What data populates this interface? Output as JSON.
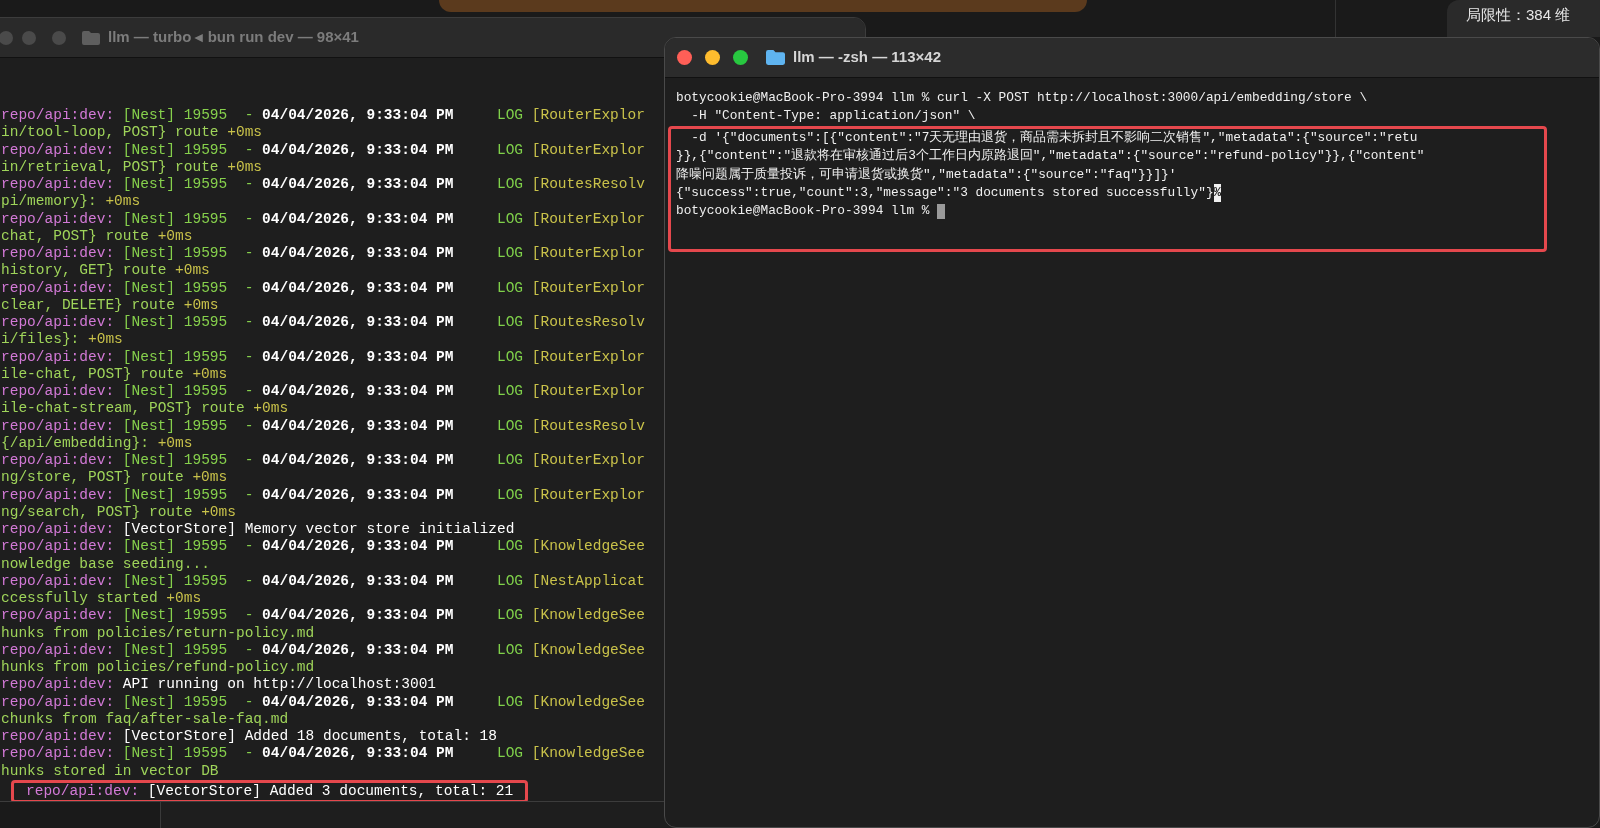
{
  "background_panel": {
    "text": "局限性：384 维"
  },
  "left_terminal": {
    "title": "llm — turbo ◂ bun run dev — 98×41",
    "lines": [
      {
        "kind": "log",
        "prefix": "repo/api:dev:",
        "source": "[Nest] 19595  -",
        "timestamp": "04/04/2026, 9:33:04 PM",
        "level": "LOG",
        "context": "[RouterExplor",
        "highlighted": false
      },
      {
        "kind": "cont",
        "text": "in/tool-loop, POST} route",
        "ms": "+0ms",
        "highlighted": false
      },
      {
        "kind": "log",
        "prefix": "repo/api:dev:",
        "source": "[Nest] 19595  -",
        "timestamp": "04/04/2026, 9:33:04 PM",
        "level": "LOG",
        "context": "[RouterExplor",
        "highlighted": false
      },
      {
        "kind": "cont",
        "text": "in/retrieval, POST} route",
        "ms": "+0ms",
        "highlighted": false
      },
      {
        "kind": "log",
        "prefix": "repo/api:dev:",
        "source": "[Nest] 19595  -",
        "timestamp": "04/04/2026, 9:33:04 PM",
        "level": "LOG",
        "context": "[RoutesResolv",
        "highlighted": false
      },
      {
        "kind": "cont",
        "text": "pi/memory}:",
        "ms": "+0ms",
        "highlighted": false
      },
      {
        "kind": "log",
        "prefix": "repo/api:dev:",
        "source": "[Nest] 19595  -",
        "timestamp": "04/04/2026, 9:33:04 PM",
        "level": "LOG",
        "context": "[RouterExplor",
        "highlighted": false
      },
      {
        "kind": "cont",
        "text": "chat, POST} route",
        "ms": "+0ms",
        "highlighted": false
      },
      {
        "kind": "log",
        "prefix": "repo/api:dev:",
        "source": "[Nest] 19595  -",
        "timestamp": "04/04/2026, 9:33:04 PM",
        "level": "LOG",
        "context": "[RouterExplor",
        "highlighted": false
      },
      {
        "kind": "cont",
        "text": "history, GET} route",
        "ms": "+0ms",
        "highlighted": false
      },
      {
        "kind": "log",
        "prefix": "repo/api:dev:",
        "source": "[Nest] 19595  -",
        "timestamp": "04/04/2026, 9:33:04 PM",
        "level": "LOG",
        "context": "[RouterExplor",
        "highlighted": false
      },
      {
        "kind": "cont",
        "text": "clear, DELETE} route",
        "ms": "+0ms",
        "highlighted": false
      },
      {
        "kind": "log",
        "prefix": "repo/api:dev:",
        "source": "[Nest] 19595  -",
        "timestamp": "04/04/2026, 9:33:04 PM",
        "level": "LOG",
        "context": "[RoutesResolv",
        "highlighted": false
      },
      {
        "kind": "cont",
        "text": "i/files}:",
        "ms": "+0ms",
        "highlighted": false
      },
      {
        "kind": "log",
        "prefix": "repo/api:dev:",
        "source": "[Nest] 19595  -",
        "timestamp": "04/04/2026, 9:33:04 PM",
        "level": "LOG",
        "context": "[RouterExplor",
        "highlighted": false
      },
      {
        "kind": "cont",
        "text": "ile-chat, POST} route",
        "ms": "+0ms",
        "highlighted": false
      },
      {
        "kind": "log",
        "prefix": "repo/api:dev:",
        "source": "[Nest] 19595  -",
        "timestamp": "04/04/2026, 9:33:04 PM",
        "level": "LOG",
        "context": "[RouterExplor",
        "highlighted": false
      },
      {
        "kind": "cont",
        "text": "ile-chat-stream, POST} route",
        "ms": "+0ms",
        "highlighted": false
      },
      {
        "kind": "log",
        "prefix": "repo/api:dev:",
        "source": "[Nest] 19595  -",
        "timestamp": "04/04/2026, 9:33:04 PM",
        "level": "LOG",
        "context": "[RoutesResolv",
        "highlighted": false
      },
      {
        "kind": "cont",
        "text": "{/api/embedding}:",
        "ms": "+0ms",
        "highlighted": false
      },
      {
        "kind": "log",
        "prefix": "repo/api:dev:",
        "source": "[Nest] 19595  -",
        "timestamp": "04/04/2026, 9:33:04 PM",
        "level": "LOG",
        "context": "[RouterExplor",
        "highlighted": false
      },
      {
        "kind": "cont",
        "text": "ng/store, POST} route",
        "ms": "+0ms",
        "highlighted": false
      },
      {
        "kind": "log",
        "prefix": "repo/api:dev:",
        "source": "[Nest] 19595  -",
        "timestamp": "04/04/2026, 9:33:04 PM",
        "level": "LOG",
        "context": "[RouterExplor",
        "highlighted": false
      },
      {
        "kind": "cont",
        "text": "ng/search, POST} route",
        "ms": "+0ms",
        "highlighted": false
      },
      {
        "kind": "plain",
        "prefix": "repo/api:dev:",
        "text": "[VectorStore] Memory vector store initialized",
        "highlighted": false
      },
      {
        "kind": "log",
        "prefix": "repo/api:dev:",
        "source": "[Nest] 19595  -",
        "timestamp": "04/04/2026, 9:33:04 PM",
        "level": "LOG",
        "context": "[KnowledgeSee",
        "highlighted": false
      },
      {
        "kind": "cont",
        "text": "nowledge base seeding...",
        "highlighted": false
      },
      {
        "kind": "log",
        "prefix": "repo/api:dev:",
        "source": "[Nest] 19595  -",
        "timestamp": "04/04/2026, 9:33:04 PM",
        "level": "LOG",
        "context": "[NestApplicat",
        "highlighted": false
      },
      {
        "kind": "cont",
        "text": "ccessfully started",
        "ms": "+0ms",
        "highlighted": false
      },
      {
        "kind": "log",
        "prefix": "repo/api:dev:",
        "source": "[Nest] 19595  -",
        "timestamp": "04/04/2026, 9:33:04 PM",
        "level": "LOG",
        "context": "[KnowledgeSee",
        "highlighted": false
      },
      {
        "kind": "cont",
        "text": "hunks from policies/return-policy.md",
        "highlighted": false
      },
      {
        "kind": "log",
        "prefix": "repo/api:dev:",
        "source": "[Nest] 19595  -",
        "timestamp": "04/04/2026, 9:33:04 PM",
        "level": "LOG",
        "context": "[KnowledgeSee",
        "highlighted": false
      },
      {
        "kind": "cont",
        "text": "hunks from policies/refund-policy.md",
        "highlighted": false
      },
      {
        "kind": "plain",
        "prefix": "repo/api:dev:",
        "text": "API running on http://localhost:3001",
        "highlighted": false
      },
      {
        "kind": "log",
        "prefix": "repo/api:dev:",
        "source": "[Nest] 19595  -",
        "timestamp": "04/04/2026, 9:33:04 PM",
        "level": "LOG",
        "context": "[KnowledgeSee",
        "highlighted": false
      },
      {
        "kind": "cont",
        "text": "chunks from faq/after-sale-faq.md",
        "highlighted": false
      },
      {
        "kind": "plain",
        "prefix": "repo/api:dev:",
        "text": "[VectorStore] Added 18 documents, total: 18",
        "highlighted": false
      },
      {
        "kind": "log",
        "prefix": "repo/api:dev:",
        "source": "[Nest] 19595  -",
        "timestamp": "04/04/2026, 9:33:04 PM",
        "level": "LOG",
        "context": "[KnowledgeSee",
        "highlighted": false
      },
      {
        "kind": "cont",
        "text": "hunks stored in vector DB",
        "highlighted": false
      },
      {
        "kind": "plain",
        "prefix": "repo/api:dev:",
        "text": "[VectorStore] Added 3 documents, total: 21",
        "highlighted": true
      }
    ]
  },
  "right_terminal": {
    "title": "llm — -zsh — 113×42",
    "lines": [
      {
        "text": "botycookie@MacBook-Pro-3994 llm % curl -X POST http://localhost:3000/api/embedding/store \\",
        "highlighted": false,
        "cursor": false
      },
      {
        "text": "  -H \"Content-Type: application/json\" \\",
        "highlighted": false,
        "cursor": false
      },
      {
        "text": "  -d '{\"documents\":[{\"content\":\"7天无理由退货，商品需未拆封且不影响二次销售\",\"metadata\":{\"source\":\"retu",
        "highlighted": true,
        "cursor": false
      },
      {
        "text": "}},{\"content\":\"退款将在审核通过后3个工作日内原路退回\",\"metadata\":{\"source\":\"refund-policy\"}},{\"content\"",
        "highlighted": true,
        "cursor": false
      },
      {
        "text": "降噪问题属于质量投诉，可申请退货或换货\",\"metadata\":{\"source\":\"faq\"}}]}'",
        "highlighted": true,
        "cursor": false
      },
      {
        "text": "{\"success\":true,\"count\":3,\"message\":\"3 documents stored successfully\"}",
        "end_mark": "%",
        "highlighted": true,
        "cursor": false
      },
      {
        "text": "botycookie@MacBook-Pro-3994 llm %",
        "highlighted": true,
        "cursor": true
      }
    ]
  }
}
